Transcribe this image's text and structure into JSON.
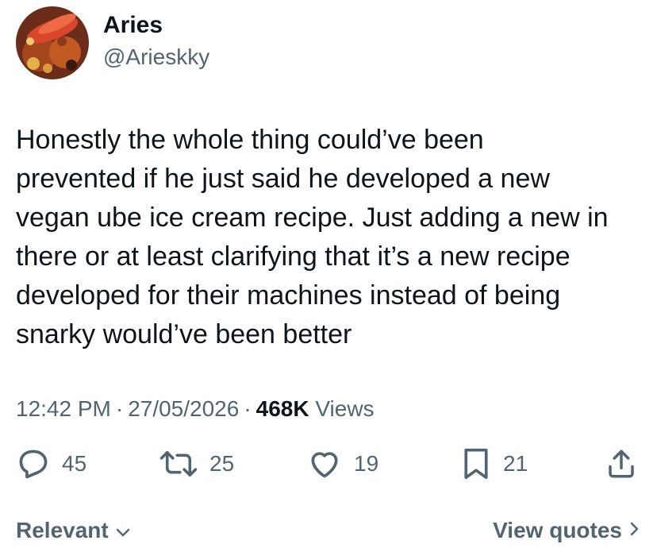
{
  "author": {
    "name": "Aries",
    "handle": "@Arieskky",
    "avatar_icon": "avatar-seafood-boil-photo"
  },
  "tweet": {
    "lines": [
      "Honestly the whole thing could’ve been",
      "prevented if he just said he developed a new",
      "vegan ube ice cream recipe. Just adding a new in",
      "there or at least clarifying that it’s a new recipe",
      "developed for their machines instead of being",
      "snarky would’ve been better"
    ]
  },
  "meta": {
    "time": "12:42 PM",
    "separator": "·",
    "date": "27/05/2026",
    "views_count": "468K",
    "views_label": "Views"
  },
  "actions": {
    "replies": "45",
    "reposts": "25",
    "likes": "19",
    "bookmarks": "21"
  },
  "footer": {
    "sort_label": "Relevant",
    "quotes_label": "View quotes"
  },
  "colors": {
    "text_primary": "#0f1419",
    "text_secondary": "#536471",
    "icon": "#536471"
  }
}
